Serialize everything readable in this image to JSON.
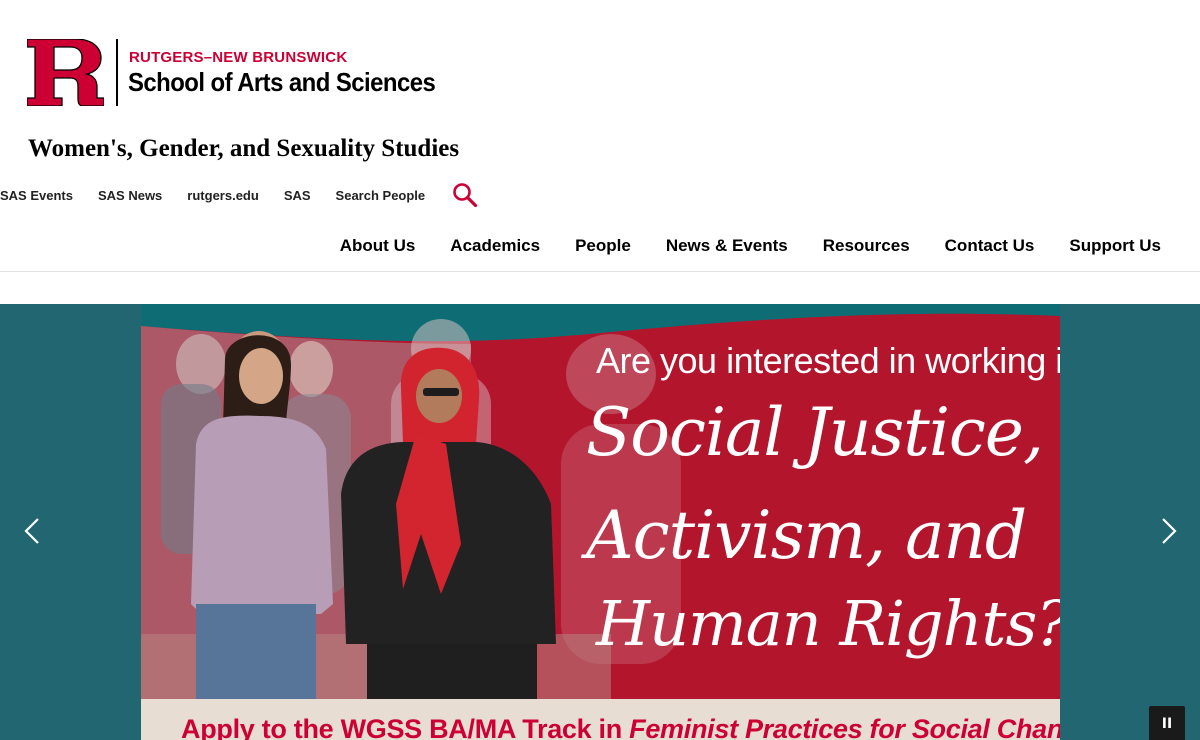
{
  "header": {
    "logo": {
      "university": "RUTGERS–NEW BRUNSWICK",
      "school": "School of Arts and Sciences"
    },
    "department": "Women's, Gender, and Sexuality Studies",
    "utility_links": [
      "SAS Events",
      "SAS News",
      "rutgers.edu",
      "SAS",
      "Search People"
    ],
    "search_icon": "search-icon",
    "main_nav": [
      "About Us",
      "Academics",
      "People",
      "News & Events",
      "Resources",
      "Contact Us",
      "Support Us"
    ]
  },
  "hero": {
    "question_line": "Are you interested in working in",
    "headline_line1": "Social Justice,",
    "headline_line2": "Activism, and",
    "headline_line3": "Human Rights?",
    "apply_prefix": "Apply to the WGSS BA/MA Track in ",
    "apply_italic": "Feminist Practices for Social Change",
    "prev_icon": "chevron-left-icon",
    "next_icon": "chevron-right-icon",
    "pause_icon": "pause-icon",
    "pause_glyph": "II"
  },
  "colors": {
    "brand_red": "#cc0033",
    "hero_teal": "#216671",
    "slide_red": "#b3152d"
  }
}
